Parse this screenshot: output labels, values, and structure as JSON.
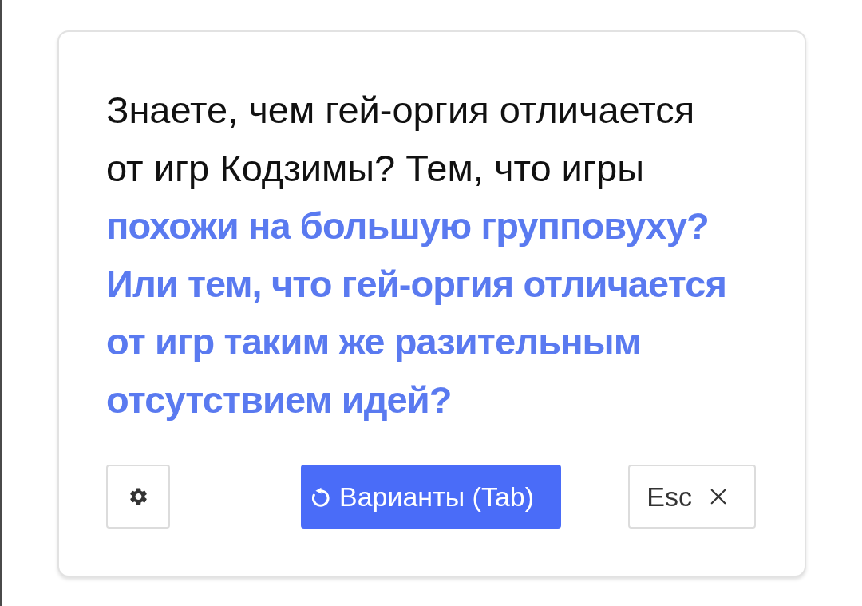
{
  "card": {
    "text": "Знаете, чем гей-оргия отличается от игр Кодзимы? Тем, что игры **похожи на большую групповуху? Или тем, что гей-оргия отличается от игр таким же разительным отсутствием идей?**",
    "buttons": [
      {
        "kind": "settings"
      },
      {
        "kind": "primary",
        "label": "Варианты (Tab)"
      },
      {
        "kind": "close",
        "label": "Esc"
      }
    ]
  }
}
